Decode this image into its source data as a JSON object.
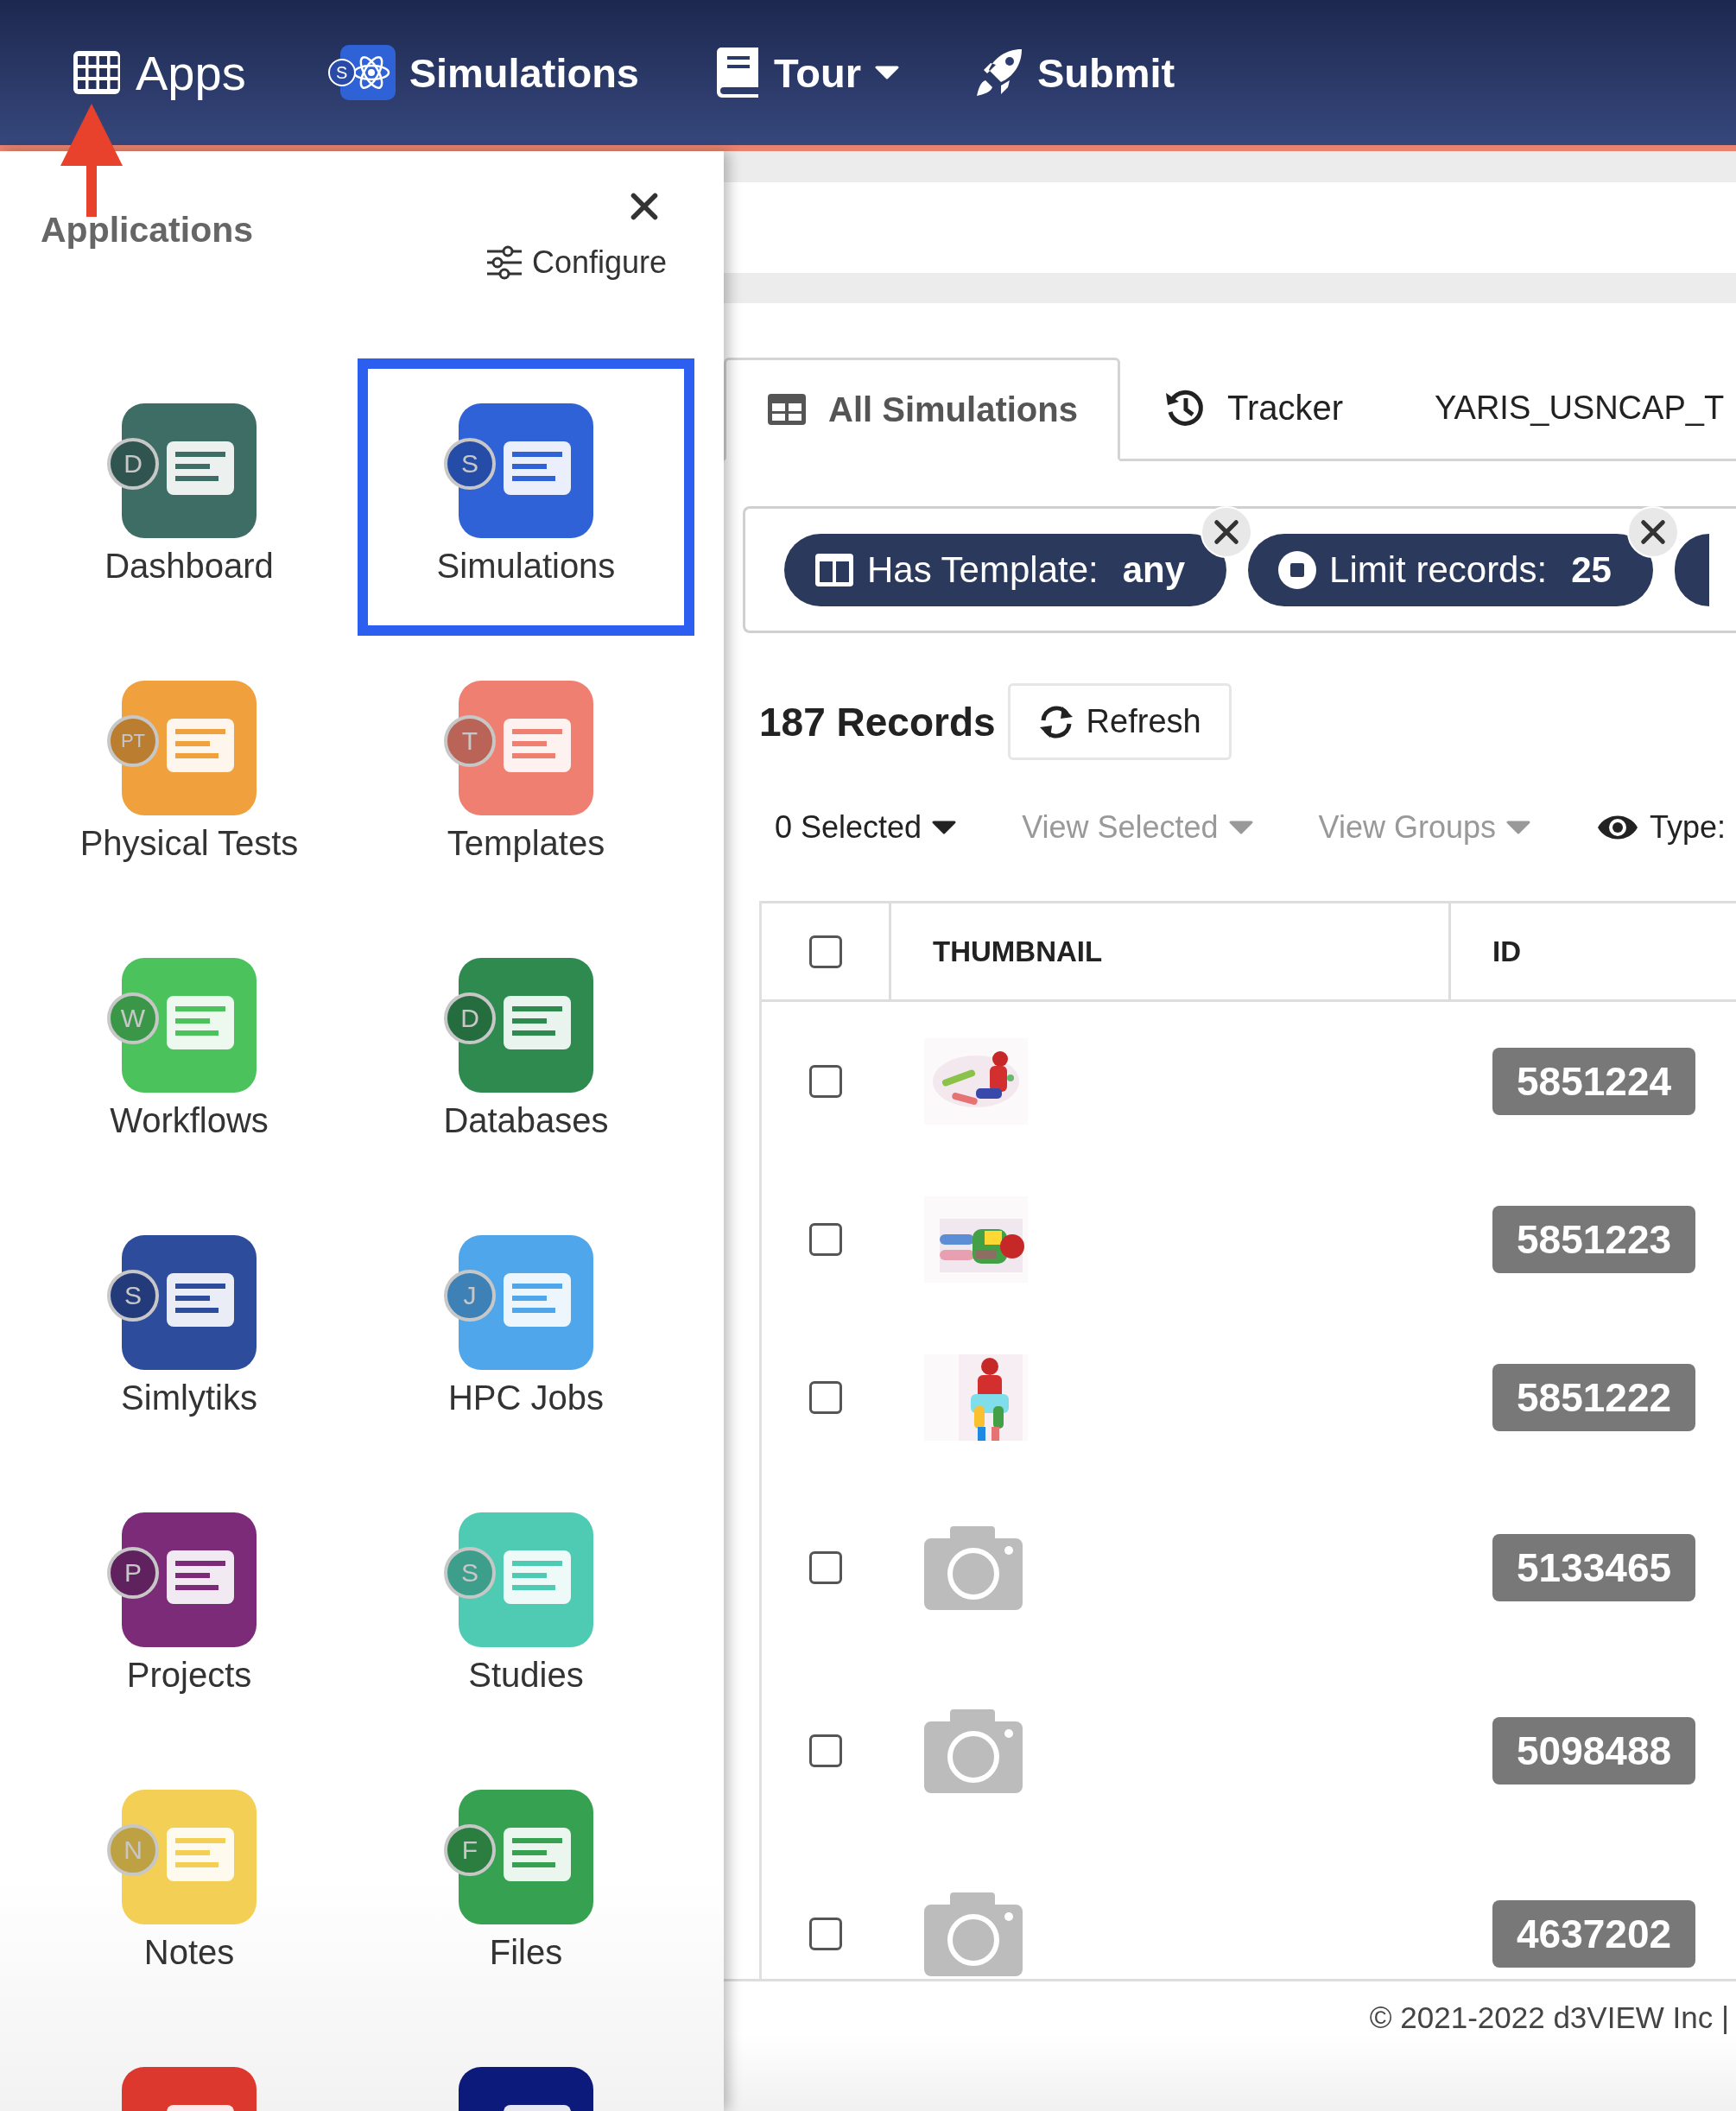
{
  "nav": {
    "items": [
      {
        "label": "Apps",
        "kind": "grid",
        "dropdown": false
      },
      {
        "label": "Simulations",
        "kind": "app",
        "badge": "S",
        "dropdown": false
      },
      {
        "label": "Tour",
        "kind": "book",
        "dropdown": true
      },
      {
        "label": "Submit",
        "kind": "rocket",
        "dropdown": false
      }
    ]
  },
  "apps_panel": {
    "title": "Applications",
    "configure": "Configure",
    "apps": [
      {
        "label": "Dashboard",
        "badge": "D",
        "color": "#3e6d66",
        "selected": false
      },
      {
        "label": "Simulations",
        "badge": "S",
        "color": "#2f62d6",
        "selected": true
      },
      {
        "label": "Physical Tests",
        "badge": "PT",
        "color": "#f0a03c",
        "selected": false
      },
      {
        "label": "Templates",
        "badge": "T",
        "color": "#ef7f70",
        "selected": false
      },
      {
        "label": "Workflows",
        "badge": "W",
        "color": "#4cc25c",
        "selected": false
      },
      {
        "label": "Databases",
        "badge": "D",
        "color": "#2f8a50",
        "selected": false
      },
      {
        "label": "Simlytiks",
        "badge": "S",
        "color": "#2d4c9c",
        "selected": false
      },
      {
        "label": "HPC Jobs",
        "badge": "J",
        "color": "#4fa6ea",
        "selected": false
      },
      {
        "label": "Projects",
        "badge": "P",
        "color": "#7b2b78",
        "selected": false
      },
      {
        "label": "Studies",
        "badge": "S",
        "color": "#4fcab3",
        "selected": false
      },
      {
        "label": "Notes",
        "badge": "N",
        "color": "#f4cf55",
        "selected": false
      },
      {
        "label": "Files",
        "badge": "F",
        "color": "#37a152",
        "selected": false
      },
      {
        "color": "#dc382e",
        "selected": false
      },
      {
        "color": "#0c1a7c",
        "selected": false
      }
    ]
  },
  "tabs": [
    {
      "label": "All Simulations",
      "kind": "table",
      "selected": true
    },
    {
      "label": "Tracker",
      "kind": "history",
      "selected": false
    },
    {
      "label": "YARIS_USNCAP_T",
      "kind": "plain",
      "selected": false
    }
  ],
  "filters": [
    {
      "kind": "columns",
      "label": "Has Template:",
      "value": "any"
    },
    {
      "kind": "stop",
      "label": "Limit records:",
      "value": "25"
    },
    {
      "kind": "partial"
    }
  ],
  "records": {
    "count": "187 Records",
    "refresh": "Refresh"
  },
  "toolbar": [
    {
      "kind": "dropdown",
      "label": "0 Selected",
      "disabled": false
    },
    {
      "kind": "dropdown",
      "label": "View Selected",
      "disabled": true
    },
    {
      "kind": "dropdown",
      "label": "View Groups",
      "disabled": true
    },
    {
      "kind": "eye",
      "label": "Type:",
      "disabled": false
    }
  ],
  "table": {
    "columns": [
      "THUMBNAIL",
      "ID"
    ],
    "header_checked": false,
    "rows": [
      {
        "checked": false,
        "kind": "picture",
        "id": "5851224"
      },
      {
        "checked": false,
        "kind": "picture",
        "id": "5851223"
      },
      {
        "checked": false,
        "kind": "picture",
        "id": "5851222"
      },
      {
        "checked": false,
        "kind": "camera",
        "id": "5133465"
      },
      {
        "checked": false,
        "kind": "camera",
        "id": "5098488"
      },
      {
        "checked": false,
        "kind": "camera",
        "id": "4637202"
      }
    ]
  },
  "footer": "© 2021-2022 d3VIEW Inc |"
}
